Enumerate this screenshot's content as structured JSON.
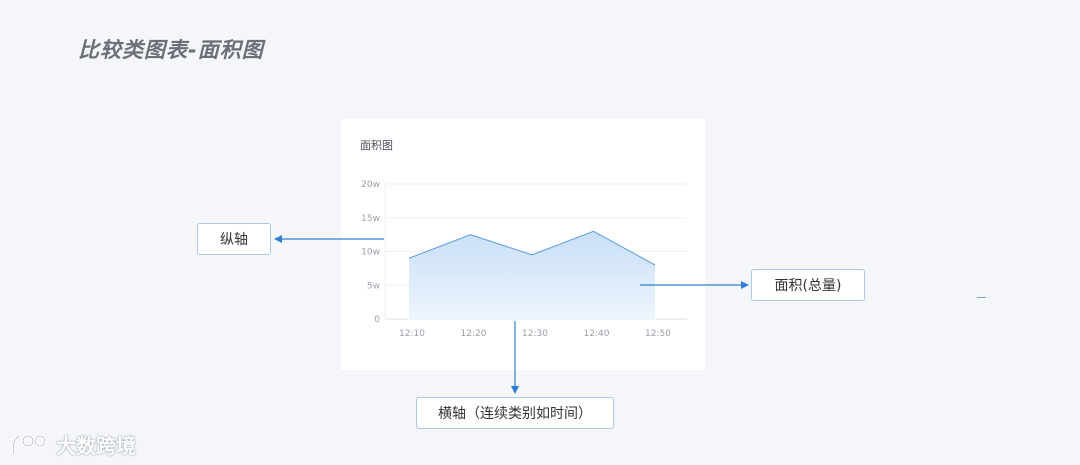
{
  "page": {
    "title": "比较类图表-面积图"
  },
  "card": {
    "title": "面积图"
  },
  "callouts": {
    "y_axis": "纵轴",
    "area_total": "面积(总量)",
    "x_axis": "横轴（连续类别如时间）"
  },
  "watermark": {
    "text": "大数跨境"
  },
  "colors": {
    "line": "#5b9be0",
    "fill_top": "#c9dff8",
    "fill_bottom": "#eef5fd",
    "arrow": "#2f7fd6"
  },
  "chart_data": {
    "type": "area",
    "title": "面积图",
    "x": [
      "12:10",
      "12:20",
      "12:30",
      "12:40",
      "12:50"
    ],
    "series": [
      {
        "values": [
          9,
          12.5,
          9.5,
          13,
          8
        ]
      }
    ],
    "y_ticks": [
      "0",
      "5w",
      "10w",
      "15w",
      "20w"
    ],
    "ylim": [
      0,
      20
    ],
    "grid": true
  }
}
